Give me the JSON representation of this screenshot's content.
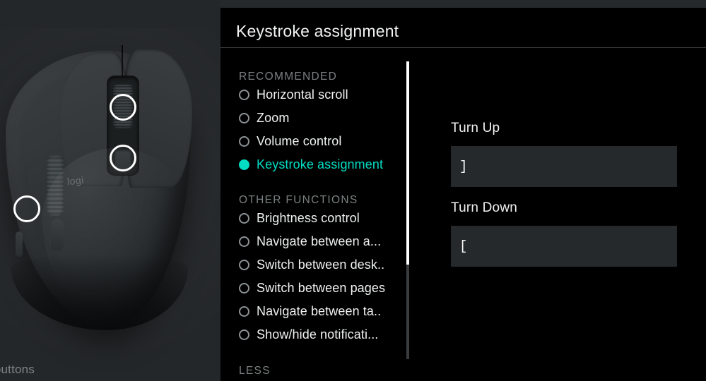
{
  "window": {
    "panel_title": "Keystroke assignment"
  },
  "device": {
    "brand_mark": "logi",
    "caption_partial": "t buttons",
    "highlights": [
      {
        "name": "scroll-wheel-highlight"
      },
      {
        "name": "middle-button-highlight"
      },
      {
        "name": "gesture-button-highlight"
      }
    ]
  },
  "function_list": {
    "groups": [
      {
        "label": "RECOMMENDED",
        "items": [
          {
            "label": "Horizontal scroll",
            "selected": false
          },
          {
            "label": "Zoom",
            "selected": false
          },
          {
            "label": "Volume control",
            "selected": false
          },
          {
            "label": "Keystroke assignment",
            "selected": true
          }
        ]
      },
      {
        "label": "OTHER FUNCTIONS",
        "items": [
          {
            "label": "Brightness control",
            "selected": false
          },
          {
            "label": "Navigate between a...",
            "selected": false
          },
          {
            "label": "Switch between desk..",
            "selected": false
          },
          {
            "label": "Switch between pages",
            "selected": false
          },
          {
            "label": "Navigate between ta..",
            "selected": false
          },
          {
            "label": "Show/hide notificati...",
            "selected": false
          }
        ]
      }
    ],
    "collapse_label": "LESS"
  },
  "detail": {
    "fields": [
      {
        "label": "Turn Up",
        "value": "]",
        "placeholder": ""
      },
      {
        "label": "Turn Down",
        "value": "[",
        "placeholder": ""
      }
    ]
  },
  "colors": {
    "accent_teal": "#00ddc4",
    "panel_background": "#000000",
    "device_pane_background": "#242729",
    "input_background": "#26292b",
    "muted_text": "#7b8082",
    "primary_text": "#f0f2f2"
  }
}
